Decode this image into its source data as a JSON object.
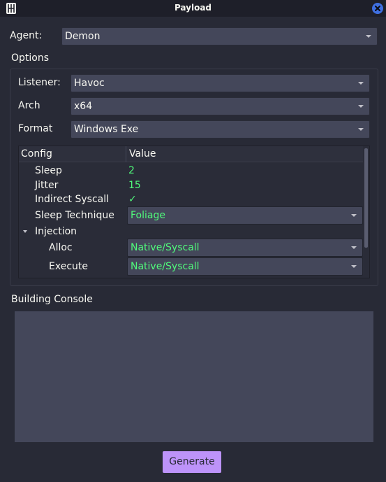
{
  "window": {
    "title": "Payload",
    "app_icon": "havoc-logo-icon",
    "close_icon": "close-icon"
  },
  "agent": {
    "label": "Agent:",
    "value": "Demon"
  },
  "options": {
    "title": "Options",
    "listener": {
      "label": "Listener:",
      "value": "Havoc"
    },
    "arch": {
      "label": "Arch",
      "value": "x64"
    },
    "format": {
      "label": "Format",
      "value": "Windows Exe"
    },
    "config": {
      "headers": [
        "Config",
        "Value"
      ],
      "rows": [
        {
          "key": "Sleep",
          "value": "2"
        },
        {
          "key": "Jitter",
          "value": "15"
        },
        {
          "key": "Indirect Syscall",
          "value": "✓"
        },
        {
          "key": "Sleep Technique",
          "value": "Foliage"
        },
        {
          "key": "Injection",
          "value": ""
        },
        {
          "key": "Alloc",
          "value": "Native/Syscall"
        },
        {
          "key": "Execute",
          "value": "Native/Syscall"
        }
      ]
    }
  },
  "console": {
    "title": "Building Console"
  },
  "generate_label": "Generate",
  "colors": {
    "background": "#282a36",
    "field": "#44475a",
    "value_green": "#50fa7b",
    "accent_purple": "#bd93f9",
    "close_blue": "#3f6fe0"
  }
}
